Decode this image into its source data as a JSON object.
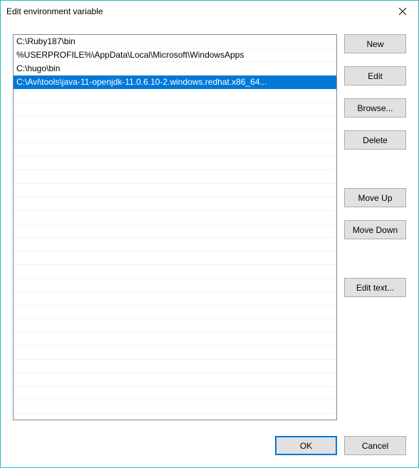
{
  "titlebar": {
    "title": "Edit environment variable"
  },
  "list": {
    "items": [
      {
        "path": "C:\\Ruby187\\bin",
        "selected": false
      },
      {
        "path": "%USERPROFILE%\\AppData\\Local\\Microsoft\\WindowsApps",
        "selected": false
      },
      {
        "path": "C:\\hugo\\bin",
        "selected": false
      },
      {
        "path": "C:\\Avi\\tools\\java-11-openjdk-11.0.6.10-2.windows.redhat.x86_64...",
        "selected": true
      }
    ]
  },
  "buttons": {
    "new": "New",
    "edit": "Edit",
    "browse": "Browse...",
    "delete": "Delete",
    "moveup": "Move Up",
    "movedown": "Move Down",
    "edittext": "Edit text...",
    "ok": "OK",
    "cancel": "Cancel"
  }
}
